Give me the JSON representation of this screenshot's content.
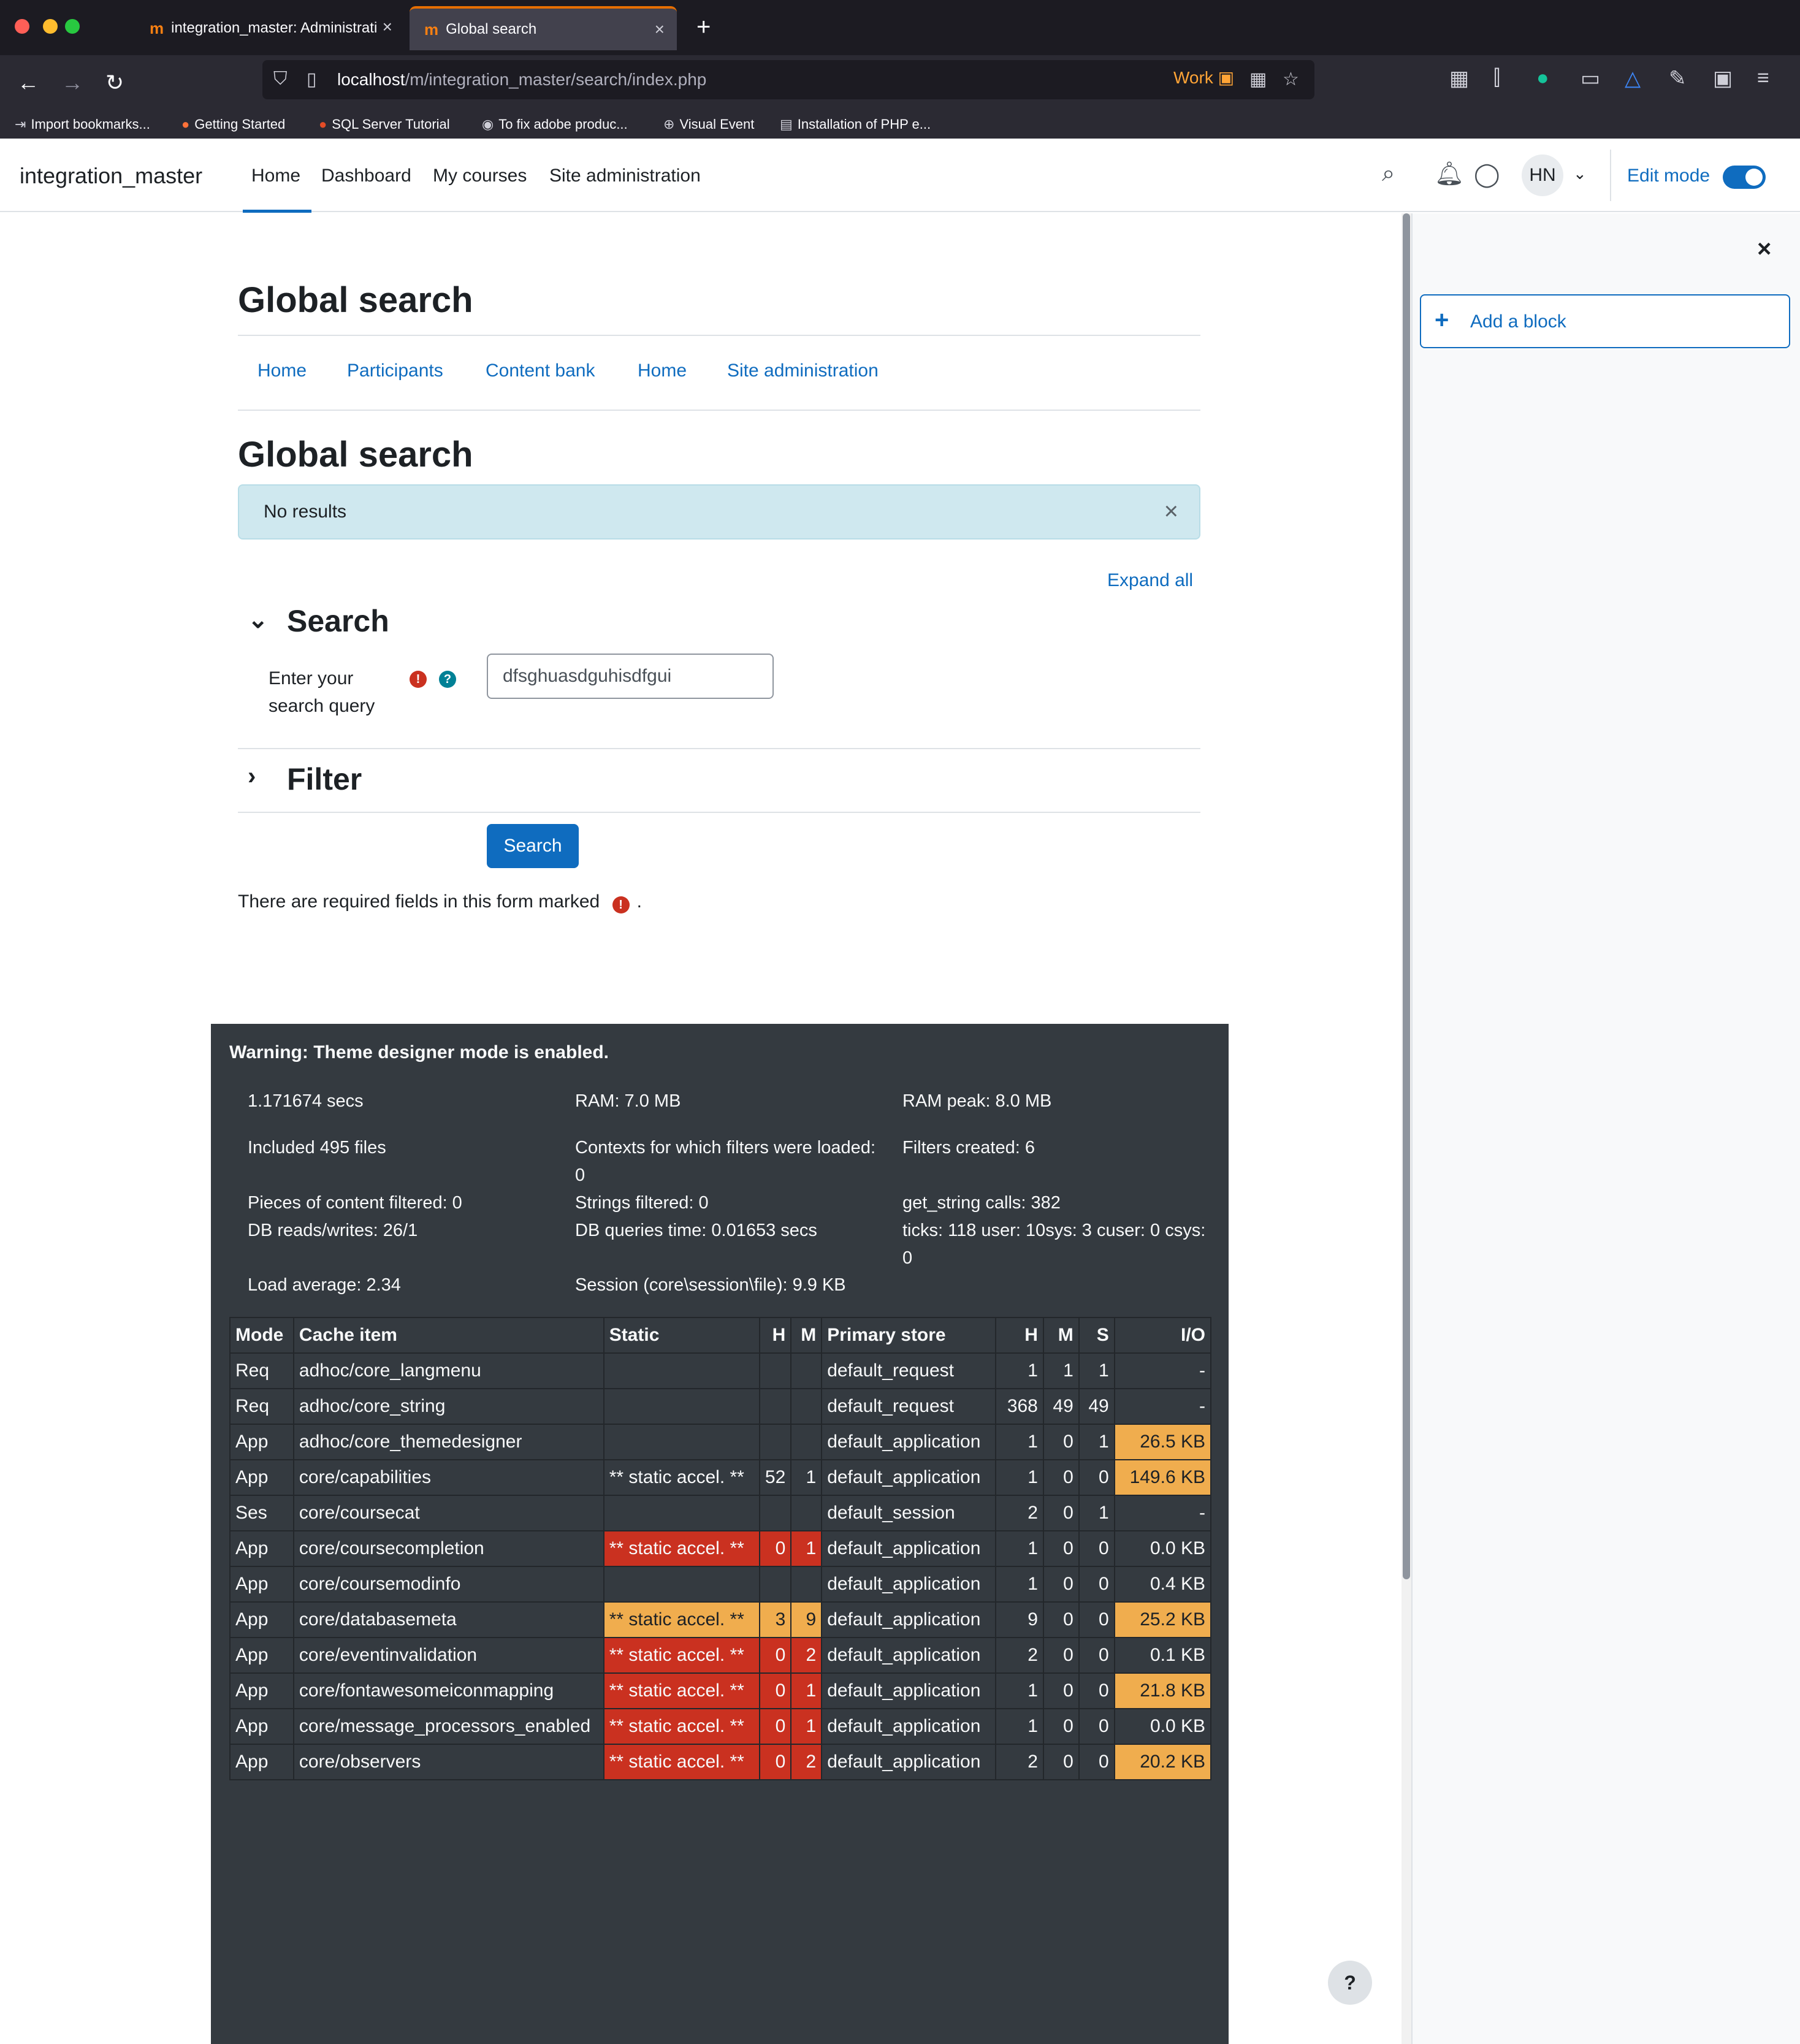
{
  "browser": {
    "tabs": [
      {
        "label": "integration_master: Administrati",
        "active": false
      },
      {
        "label": "Global search",
        "active": true
      }
    ],
    "url_host": "localhost",
    "url_path": "/m/integration_master/search/index.php",
    "container_label": "Work",
    "bookmarks": [
      "Import bookmarks...",
      "Getting Started",
      "SQL Server Tutorial",
      "To fix adobe produc...",
      "Visual Event",
      "Installation of PHP e..."
    ]
  },
  "header": {
    "brand": "integration_master",
    "nav": [
      "Home",
      "Dashboard",
      "My courses",
      "Site administration"
    ],
    "avatar_initials": "HN",
    "edit_mode_label": "Edit mode"
  },
  "page": {
    "title": "Global search",
    "secondary_nav": [
      "Home",
      "Participants",
      "Content bank",
      "Home",
      "Site administration"
    ],
    "subtitle": "Global search",
    "alert": "No results",
    "expand_all": "Expand all",
    "search_section": "Search",
    "field_label": "Enter your search query",
    "query_value": "dfsghuasdguhisdfgui",
    "filter_section": "Filter",
    "search_button": "Search",
    "required_note": "There are required fields in this form marked",
    "required_note_end": "."
  },
  "perf": {
    "warning": "Warning: Theme designer mode is enabled.",
    "col1": [
      "1.171674 secs",
      "Included 495 files",
      "Pieces of content filtered: 0",
      "DB reads/writes: 26/1",
      "Load average: 2.34"
    ],
    "col2": [
      "RAM: 7.0 MB",
      "Contexts for which filters were loaded: 0",
      "Strings filtered: 0",
      "DB queries time: 0.01653 secs",
      "Session (core\\session\\file): 9.9 KB"
    ],
    "col3": [
      "RAM peak: 8.0 MB",
      "Filters created: 6",
      "get_string calls: 382",
      "ticks: 118 user: 10sys: 3 cuser: 0 csys: 0"
    ],
    "table_headers": [
      "Mode",
      "Cache item",
      "Static",
      "H",
      "M",
      "Primary store",
      "H",
      "M",
      "S",
      "I/O"
    ],
    "rows": [
      {
        "mode": "Req",
        "item": "adhoc/core_langmenu",
        "static": "",
        "sh": "",
        "sm": "",
        "store": "default_request",
        "h": "1",
        "m": "1",
        "s": "1",
        "io": "-",
        "static_color": "",
        "io_color": ""
      },
      {
        "mode": "Req",
        "item": "adhoc/core_string",
        "static": "",
        "sh": "",
        "sm": "",
        "store": "default_request",
        "h": "368",
        "m": "49",
        "s": "49",
        "io": "-",
        "static_color": "",
        "io_color": ""
      },
      {
        "mode": "App",
        "item": "adhoc/core_themedesigner",
        "static": "",
        "sh": "",
        "sm": "",
        "store": "default_application",
        "h": "1",
        "m": "0",
        "s": "1",
        "io": "26.5 KB",
        "static_color": "",
        "io_color": "orange"
      },
      {
        "mode": "App",
        "item": "core/capabilities",
        "static": "** static accel. **",
        "sh": "52",
        "sm": "1",
        "store": "default_application",
        "h": "1",
        "m": "0",
        "s": "0",
        "io": "149.6 KB",
        "static_color": "",
        "io_color": "orange"
      },
      {
        "mode": "Ses",
        "item": "core/coursecat",
        "static": "",
        "sh": "",
        "sm": "",
        "store": "default_session",
        "h": "2",
        "m": "0",
        "s": "1",
        "io": "-",
        "static_color": "",
        "io_color": ""
      },
      {
        "mode": "App",
        "item": "core/coursecompletion",
        "static": "** static accel. **",
        "sh": "0",
        "sm": "1",
        "store": "default_application",
        "h": "1",
        "m": "0",
        "s": "0",
        "io": "0.0 KB",
        "static_color": "red",
        "io_color": ""
      },
      {
        "mode": "App",
        "item": "core/coursemodinfo",
        "static": "",
        "sh": "",
        "sm": "",
        "store": "default_application",
        "h": "1",
        "m": "0",
        "s": "0",
        "io": "0.4 KB",
        "static_color": "",
        "io_color": ""
      },
      {
        "mode": "App",
        "item": "core/databasemeta",
        "static": "** static accel. **",
        "sh": "3",
        "sm": "9",
        "store": "default_application",
        "h": "9",
        "m": "0",
        "s": "0",
        "io": "25.2 KB",
        "static_color": "orange",
        "io_color": "orange"
      },
      {
        "mode": "App",
        "item": "core/eventinvalidation",
        "static": "** static accel. **",
        "sh": "0",
        "sm": "2",
        "store": "default_application",
        "h": "2",
        "m": "0",
        "s": "0",
        "io": "0.1 KB",
        "static_color": "red",
        "io_color": ""
      },
      {
        "mode": "App",
        "item": "core/fontawesomeiconmapping",
        "static": "** static accel. **",
        "sh": "0",
        "sm": "1",
        "store": "default_application",
        "h": "1",
        "m": "0",
        "s": "0",
        "io": "21.8 KB",
        "static_color": "red",
        "io_color": "orange"
      },
      {
        "mode": "App",
        "item": "core/message_processors_enabled",
        "static": "** static accel. **",
        "sh": "0",
        "sm": "1",
        "store": "default_application",
        "h": "1",
        "m": "0",
        "s": "0",
        "io": "0.0 KB",
        "static_color": "red",
        "io_color": ""
      },
      {
        "mode": "App",
        "item": "core/observers",
        "static": "** static accel. **",
        "sh": "0",
        "sm": "2",
        "store": "default_application",
        "h": "2",
        "m": "0",
        "s": "0",
        "io": "20.2 KB",
        "static_color": "red",
        "io_color": "orange"
      }
    ]
  },
  "drawer": {
    "add_block": "Add a block"
  },
  "help_button": "?",
  "colors": {
    "primary": "#0f6cbf",
    "alert_bg": "#cfe8ef",
    "danger": "#ca3120",
    "warning": "#f0ad4e",
    "perf_bg": "#343a40"
  },
  "icons": {
    "search": "search-icon",
    "bell": "bell-icon",
    "chat": "chat-icon",
    "close": "close-icon",
    "required": "exclamation-circle-icon",
    "help": "question-circle-icon"
  }
}
